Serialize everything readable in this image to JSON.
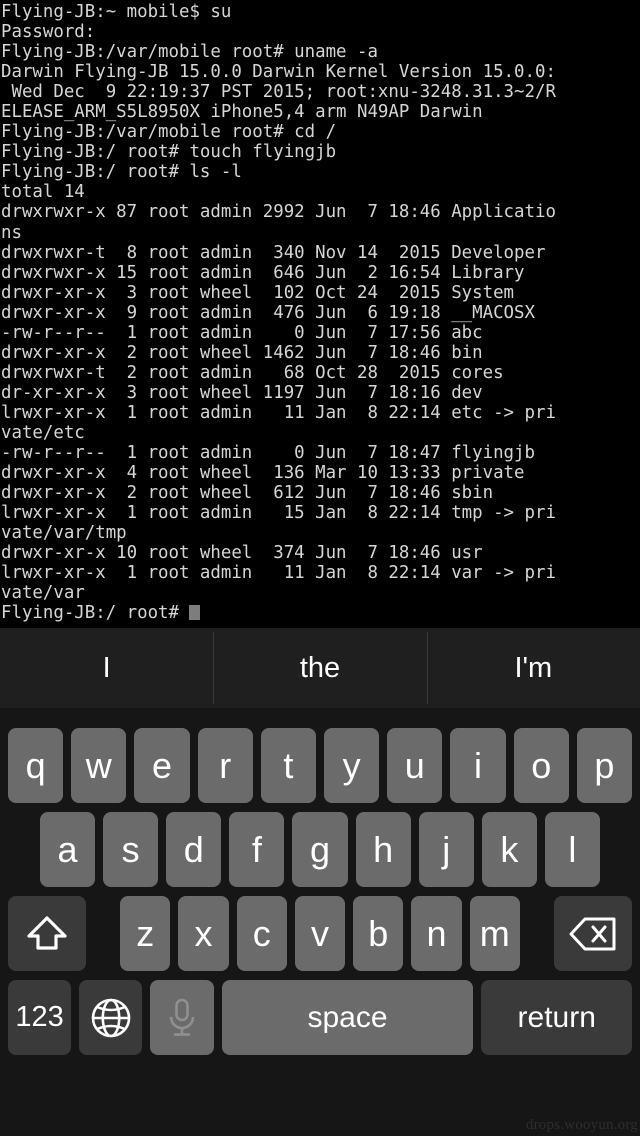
{
  "terminal": {
    "background_color": "#000000",
    "text_color": "#d6d6d6",
    "cursor_color": "#7d7d7d",
    "lines": [
      "Flying-JB:~ mobile$ su",
      "Password:",
      "Flying-JB:/var/mobile root# uname -a",
      "Darwin Flying-JB 15.0.0 Darwin Kernel Version 15.0.0:",
      " Wed Dec  9 22:19:37 PST 2015; root:xnu-3248.31.3~2/R",
      "ELEASE_ARM_S5L8950X iPhone5,4 arm N49AP Darwin",
      "Flying-JB:/var/mobile root# cd /",
      "Flying-JB:/ root# touch flyingjb",
      "Flying-JB:/ root# ls -l",
      "total 14",
      "drwxrwxr-x 87 root admin 2992 Jun  7 18:46 Applicatio",
      "ns",
      "drwxrwxr-t  8 root admin  340 Nov 14  2015 Developer",
      "drwxrwxr-x 15 root admin  646 Jun  2 16:54 Library",
      "drwxr-xr-x  3 root wheel  102 Oct 24  2015 System",
      "drwxr-xr-x  9 root admin  476 Jun  6 19:18 __MACOSX",
      "-rw-r--r--  1 root admin    0 Jun  7 17:56 abc",
      "drwxr-xr-x  2 root wheel 1462 Jun  7 18:46 bin",
      "drwxrwxr-t  2 root admin   68 Oct 28  2015 cores",
      "dr-xr-xr-x  3 root wheel 1197 Jun  7 18:16 dev",
      "lrwxr-xr-x  1 root admin   11 Jan  8 22:14 etc -> pri",
      "vate/etc",
      "-rw-r--r--  1 root admin    0 Jun  7 18:47 flyingjb",
      "drwxr-xr-x  4 root wheel  136 Mar 10 13:33 private",
      "drwxr-xr-x  2 root wheel  612 Jun  7 18:46 sbin",
      "lrwxr-xr-x  1 root admin   15 Jan  8 22:14 tmp -> pri",
      "vate/var/tmp",
      "drwxr-xr-x 10 root wheel  374 Jun  7 18:46 usr",
      "lrwxr-xr-x  1 root admin   11 Jan  8 22:14 var -> pri",
      "vate/var"
    ],
    "prompt": "Flying-JB:/ root# ",
    "cursor_visible": true
  },
  "keyboard": {
    "theme": "dark",
    "key_color": "#6b6b6b",
    "modifier_key_color": "#3a3a3a",
    "background_color": "#161616",
    "suggestions": [
      {
        "label": "I"
      },
      {
        "label": "the"
      },
      {
        "label": "I'm"
      }
    ],
    "row1": [
      {
        "label": "q"
      },
      {
        "label": "w"
      },
      {
        "label": "e"
      },
      {
        "label": "r"
      },
      {
        "label": "t"
      },
      {
        "label": "y"
      },
      {
        "label": "u"
      },
      {
        "label": "i"
      },
      {
        "label": "o"
      },
      {
        "label": "p"
      }
    ],
    "row2": [
      {
        "label": "a"
      },
      {
        "label": "s"
      },
      {
        "label": "d"
      },
      {
        "label": "f"
      },
      {
        "label": "g"
      },
      {
        "label": "h"
      },
      {
        "label": "j"
      },
      {
        "label": "k"
      },
      {
        "label": "l"
      }
    ],
    "row3": [
      {
        "label": "z"
      },
      {
        "label": "x"
      },
      {
        "label": "c"
      },
      {
        "label": "v"
      },
      {
        "label": "b"
      },
      {
        "label": "n"
      },
      {
        "label": "m"
      }
    ],
    "shift_icon": "shift-icon",
    "backspace_icon": "backspace-icon",
    "numbers_label": "123",
    "globe_icon": "globe-icon",
    "mic_icon": "microphone-icon",
    "space_label": "space",
    "return_label": "return"
  },
  "watermark": {
    "text": "drops.wooyun.org"
  }
}
